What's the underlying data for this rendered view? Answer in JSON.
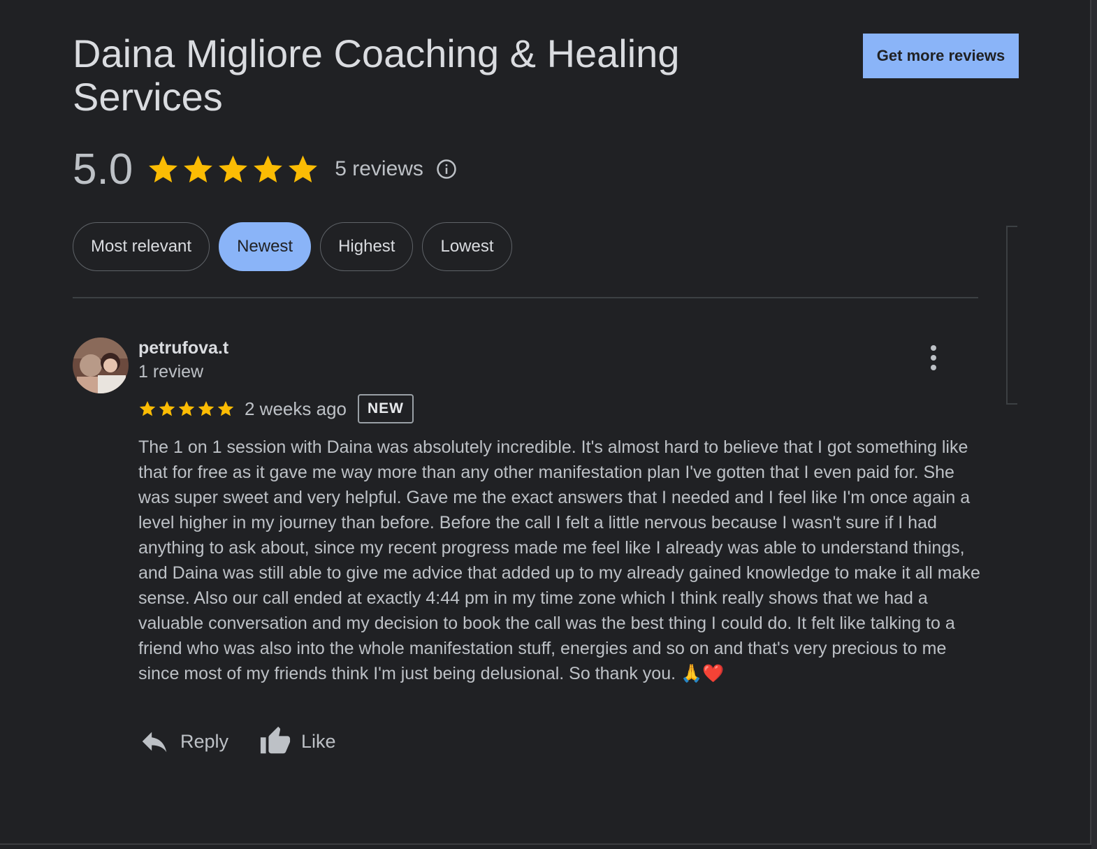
{
  "business": {
    "name": "Daina Migliore Coaching & Healing Services",
    "rating_value": "5.0",
    "rating_stars": 5,
    "review_count_label": "5 reviews",
    "cta_label": "Get more reviews"
  },
  "icons": {
    "star": "star-icon",
    "info": "info-icon",
    "more": "more-vert-icon",
    "reply": "reply-icon",
    "like": "thumb-up-icon"
  },
  "colors": {
    "background": "#202124",
    "accent": "#8ab4f8",
    "star": "#fbbc04",
    "text": "#bdc1c6"
  },
  "sort_chips": {
    "items": [
      {
        "label": "Most relevant",
        "active": false
      },
      {
        "label": "Newest",
        "active": true
      },
      {
        "label": "Highest",
        "active": false
      },
      {
        "label": "Lowest",
        "active": false
      }
    ]
  },
  "review": {
    "author": "petrufova.t",
    "author_meta": "1 review",
    "stars": 5,
    "date": "2 weeks ago",
    "badge": "NEW",
    "text": "The 1 on 1 session with Daina was absolutely incredible. It's almost hard to believe that I got something like that for free as it gave me way more than any other manifestation plan I've gotten that I even paid for. She was super sweet and very helpful. Gave me the exact answers that I needed and I feel like I'm once again a level higher in my journey than before. Before the call I felt a little nervous because I wasn't sure if I had anything to ask about, since my recent progress made me feel like I already was able to understand things, and Daina was still able to give me advice that added up to my already gained knowledge to make it all make sense. Also our call ended at exactly 4:44 pm in my time zone which I think really shows that we had a valuable conversation and my decision to book the call was the best thing I could do. It felt like talking to a friend who was also into the whole manifestation stuff, energies and so on and that's very precious to me since most of my friends think I'm just being delusional. So thank you. 🙏❤️",
    "reply_label": "Reply",
    "like_label": "Like"
  }
}
